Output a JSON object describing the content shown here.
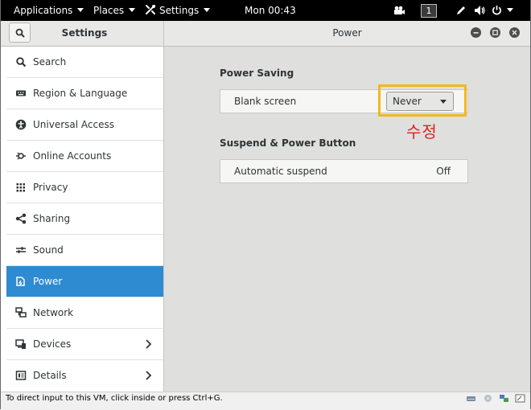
{
  "topbar": {
    "applications": "Applications",
    "places": "Places",
    "settings": "Settings",
    "clock": "Mon 00:43",
    "workspace": "1"
  },
  "header": {
    "left_title": "Settings",
    "right_title": "Power"
  },
  "sidebar": {
    "items": [
      {
        "label": "Search",
        "icon": "search-icon"
      },
      {
        "label": "Region & Language",
        "icon": "keyboard-icon"
      },
      {
        "label": "Universal Access",
        "icon": "accessibility-icon"
      },
      {
        "label": "Online Accounts",
        "icon": "online-accounts-icon"
      },
      {
        "label": "Privacy",
        "icon": "privacy-icon"
      },
      {
        "label": "Sharing",
        "icon": "share-icon"
      },
      {
        "label": "Sound",
        "icon": "sound-icon"
      },
      {
        "label": "Power",
        "icon": "power-plug-icon",
        "active": true
      },
      {
        "label": "Network",
        "icon": "network-icon"
      },
      {
        "label": "Devices",
        "icon": "devices-icon",
        "has_arrow": true
      },
      {
        "label": "Details",
        "icon": "details-icon",
        "has_arrow": true
      }
    ]
  },
  "power": {
    "power_saving_title": "Power Saving",
    "blank_screen_label": "Blank screen",
    "blank_screen_value": "Never",
    "suspend_title": "Suspend & Power Button",
    "auto_suspend_label": "Automatic suspend",
    "auto_suspend_value": "Off"
  },
  "annotation": {
    "text": "수정",
    "color": "#e02020",
    "box_color": "#f2b81c"
  },
  "statusbar": {
    "text": "To direct input to this VM, click inside or press Ctrl+G."
  },
  "colors": {
    "accent": "#2e8bd1",
    "topbar": "#000000"
  }
}
